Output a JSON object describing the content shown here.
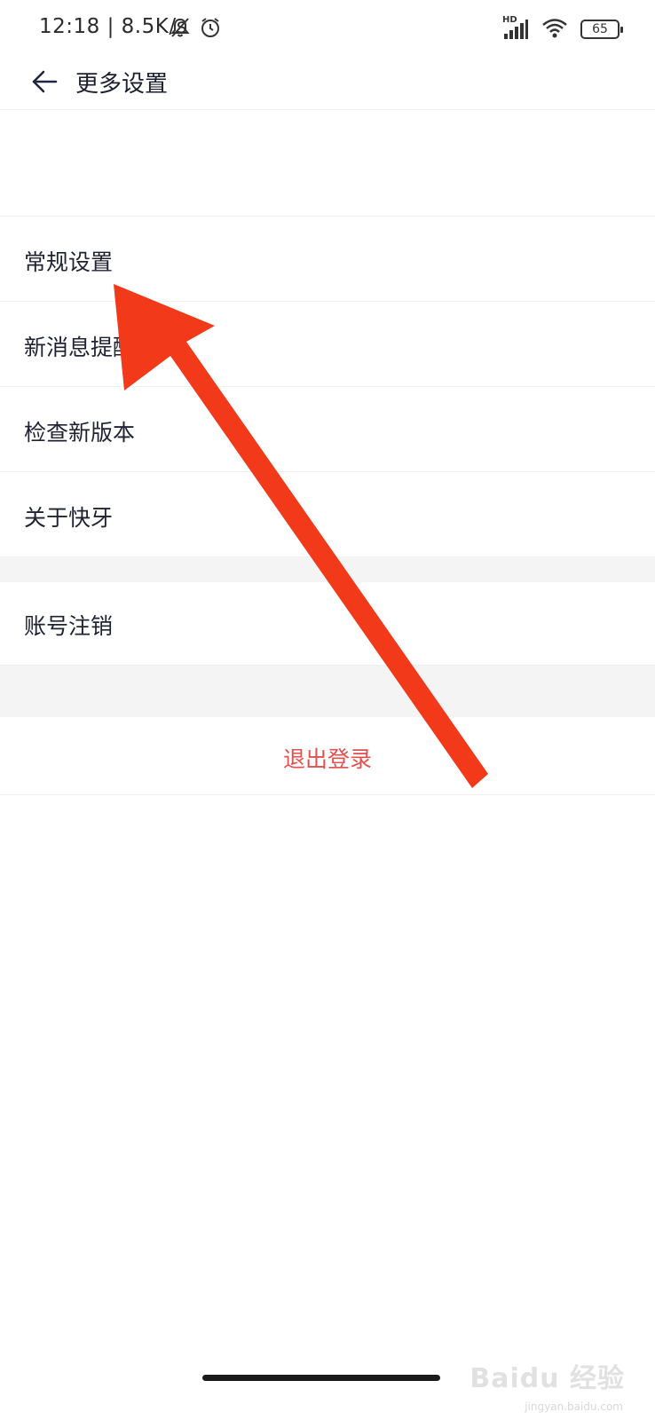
{
  "status_bar": {
    "time": "12:18 | 8.5K/s",
    "network_label": "HD",
    "battery_level": "65",
    "icons": [
      "mute-bell-icon",
      "alarm-icon",
      "signal-icon",
      "wifi-icon",
      "battery-icon"
    ]
  },
  "header": {
    "title": "更多设置",
    "back_icon": "back-arrow-icon"
  },
  "menu": {
    "items": [
      {
        "label": "常规设置"
      },
      {
        "label": "新消息提醒"
      },
      {
        "label": "检查新版本"
      },
      {
        "label": "关于快牙"
      }
    ],
    "account_item": {
      "label": "账号注销"
    },
    "logout": {
      "label": "退出登录",
      "color": "#e2514e"
    }
  },
  "annotation": {
    "color": "#f23a1a"
  },
  "watermark": {
    "text": "Baidu 经验",
    "sub": "jingyan.baidu.com"
  },
  "colors": {
    "text": "#1f2233",
    "divider": "#f0f0f0",
    "section_gap": "#f4f4f4"
  }
}
